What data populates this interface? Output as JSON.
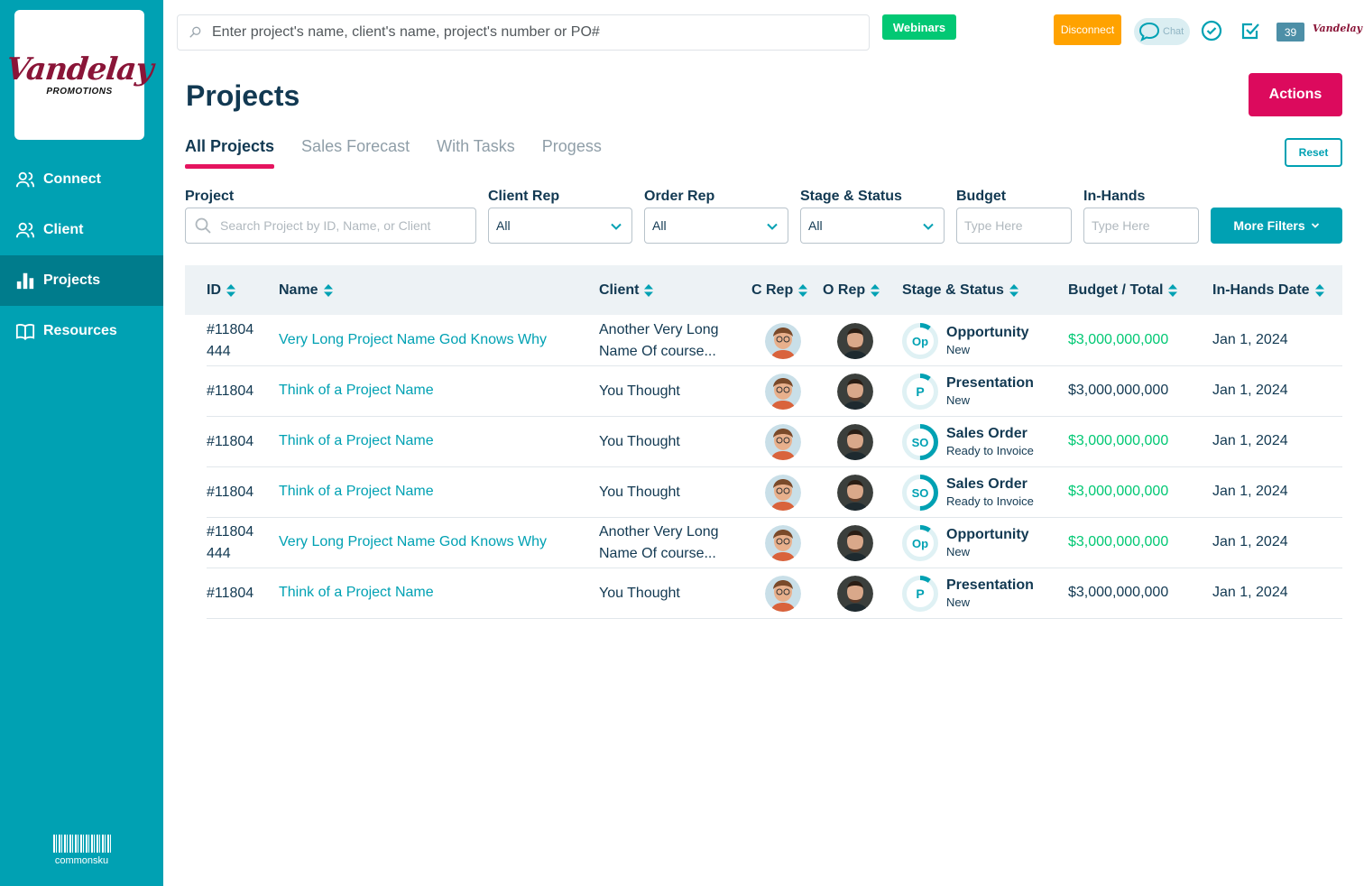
{
  "sidebar": {
    "logo_main": "Vandelay",
    "logo_sub": "PROMOTIONS",
    "items": [
      {
        "label": "Connect",
        "icon": "people-icon"
      },
      {
        "label": "Client",
        "icon": "people-icon"
      },
      {
        "label": "Projects",
        "icon": "bar-chart-icon"
      },
      {
        "label": "Resources",
        "icon": "book-icon"
      }
    ],
    "footer_brand": "commonsku"
  },
  "topbar": {
    "search_placeholder": "Enter project's name, client's name, project's number or PO#",
    "webinars_label": "Webinars",
    "disconnect_label": "Disconnect",
    "chat_label": "Chat",
    "notification_count": "39",
    "mini_logo": "Vandelay"
  },
  "page": {
    "title": "Projects",
    "actions_label": "Actions",
    "reset_label": "Reset",
    "tabs": [
      "All Projects",
      "Sales Forecast",
      "With Tasks",
      "Progess"
    ]
  },
  "filters": {
    "project_label": "Project",
    "project_placeholder": "Search Project by ID, Name, or Client",
    "client_rep_label": "Client Rep",
    "client_rep_value": "All",
    "order_rep_label": "Order Rep",
    "order_rep_value": "All",
    "stage_label": "Stage & Status",
    "stage_value": "All",
    "budget_label": "Budget",
    "budget_placeholder": "Type Here",
    "inhands_label": "In-Hands",
    "inhands_placeholder": "Type Here",
    "more_filters_label": "More Filters"
  },
  "table": {
    "headers": [
      "ID",
      "Name",
      "Client",
      "C Rep",
      "O Rep",
      "Stage & Status",
      "Budget / Total",
      "In-Hands Date"
    ],
    "rows": [
      {
        "id_line1": "#11804",
        "id_line2": "444",
        "name": "Very Long Project Name God Knows Why",
        "client_line1": "Another Very Long",
        "client_line2": "Name Of course...",
        "stage_abbr": "Op",
        "stage": "Opportunity",
        "status": "New",
        "budget": "$3,000,000,000",
        "budget_color": "#02c874",
        "date": "Jan 1, 2024",
        "progress": 0.1
      },
      {
        "id_line1": "#11804",
        "id_line2": "",
        "name": "Think of a Project Name",
        "client_line1": "You Thought",
        "client_line2": "",
        "stage_abbr": "P",
        "stage": "Presentation",
        "status": "New",
        "budget": "$3,000,000,000",
        "budget_color": "#123952",
        "date": "Jan 1, 2024",
        "progress": 0.1
      },
      {
        "id_line1": "#11804",
        "id_line2": "",
        "name": "Think of a Project Name",
        "client_line1": "You Thought",
        "client_line2": "",
        "stage_abbr": "SO",
        "stage": "Sales Order",
        "status": "Ready to Invoice",
        "budget": "$3,000,000,000",
        "budget_color": "#02c874",
        "date": "Jan 1, 2024",
        "progress": 0.5
      },
      {
        "id_line1": "#11804",
        "id_line2": "",
        "name": "Think of a Project Name",
        "client_line1": "You Thought",
        "client_line2": "",
        "stage_abbr": "SO",
        "stage": "Sales Order",
        "status": "Ready to Invoice",
        "budget": "$3,000,000,000",
        "budget_color": "#02c874",
        "date": "Jan 1, 2024",
        "progress": 0.5
      },
      {
        "id_line1": "#11804",
        "id_line2": "444",
        "name": "Very Long Project Name God Knows Why",
        "client_line1": "Another Very Long",
        "client_line2": "Name Of course...",
        "stage_abbr": "Op",
        "stage": "Opportunity",
        "status": "New",
        "budget": "$3,000,000,000",
        "budget_color": "#02c874",
        "date": "Jan 1, 2024",
        "progress": 0.1
      },
      {
        "id_line1": "#11804",
        "id_line2": "",
        "name": "Think of a Project Name",
        "client_line1": "You Thought",
        "client_line2": "",
        "stage_abbr": "P",
        "stage": "Presentation",
        "status": "New",
        "budget": "$3,000,000,000",
        "budget_color": "#123952",
        "date": "Jan 1, 2024",
        "progress": 0.1
      }
    ]
  },
  "colors": {
    "sidebar": "#00a1b3",
    "sidebar_active": "#007c8c",
    "accent_pink": "#dc0a5d",
    "link_teal": "#00a1b3",
    "money_green": "#02c874",
    "text_navy": "#123952"
  }
}
